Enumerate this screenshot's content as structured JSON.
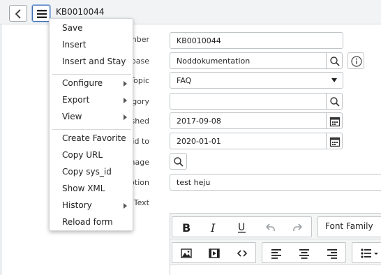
{
  "header": {
    "record_number": "KB0010044",
    "back_icon": "chevron-left-icon",
    "menu_icon": "hamburger-menu-icon"
  },
  "form": {
    "labels": {
      "number": "Number",
      "knowledge_base": "Knowledge base",
      "topic": "Topic",
      "category": "Category",
      "published": "Published",
      "valid_to": "Valid to",
      "image": "Image",
      "short_description": "Short description",
      "article_body": "Text"
    },
    "values": {
      "number": "KB0010044",
      "knowledge_base": "Noddokumentation",
      "topic": "FAQ",
      "category": "",
      "published": "2017-09-08",
      "valid_to": "2020-01-01",
      "short_description": "test heju"
    }
  },
  "editor": {
    "font_family_label": "Font Family"
  },
  "context_menu": {
    "items": [
      {
        "label": "Save"
      },
      {
        "label": "Insert"
      },
      {
        "label": "Insert and Stay"
      },
      {
        "label": "Configure",
        "submenu": true
      },
      {
        "label": "Export",
        "submenu": true
      },
      {
        "label": "View",
        "submenu": true
      },
      {
        "label": "Create Favorite"
      },
      {
        "label": "Copy URL"
      },
      {
        "label": "Copy sys_id"
      },
      {
        "label": "Show XML"
      },
      {
        "label": "History",
        "submenu": true
      },
      {
        "label": "Reload form"
      }
    ]
  },
  "colors": {
    "header_bg": "#f1f3f4",
    "menu_button_focus": "#3c6ab0",
    "border": "#bfc4c7"
  }
}
